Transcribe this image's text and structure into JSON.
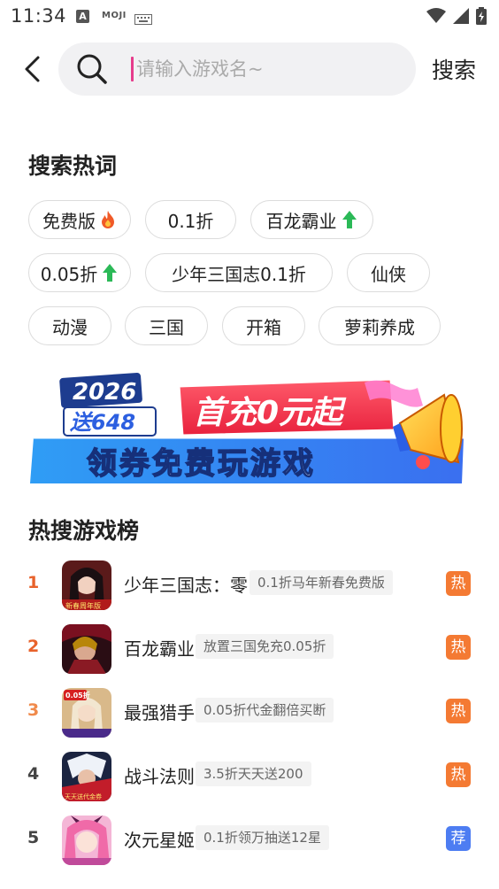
{
  "status_bar": {
    "time": "11:34",
    "app_a": "A",
    "app_moji": "MOJI"
  },
  "search": {
    "placeholder": "请输入游戏名~",
    "value": "",
    "button_label": "搜索"
  },
  "hot_words": {
    "title": "搜索热词",
    "chips": [
      {
        "label": "免费版",
        "icon": "fire-icon"
      },
      {
        "label": "0.1折",
        "icon": ""
      },
      {
        "label": "百龙霸业",
        "icon": "arrow-up-icon"
      },
      {
        "label": "0.05折",
        "icon": "arrow-up-icon"
      },
      {
        "label": "少年三国志0.1折",
        "icon": ""
      },
      {
        "label": "仙侠",
        "icon": ""
      },
      {
        "label": "动漫",
        "icon": ""
      },
      {
        "label": "三国",
        "icon": ""
      },
      {
        "label": "开箱",
        "icon": ""
      },
      {
        "label": "萝莉养成",
        "icon": ""
      }
    ]
  },
  "banner": {
    "year": "2026",
    "gift": "送648",
    "headline": "首充0元起",
    "subline": "领券免费玩游戏"
  },
  "ranking": {
    "title": "热搜游戏榜",
    "items": [
      {
        "rank": "1",
        "name": "少年三国志：零",
        "tag": "0.1折马年新春免费版",
        "badge": "热",
        "thumb_text": "新春周年版"
      },
      {
        "rank": "2",
        "name": "百龙霸业",
        "tag": "放置三国免充0.05折",
        "badge": "热",
        "thumb_text": ""
      },
      {
        "rank": "3",
        "name": "最强猎手",
        "tag": "0.05折代金翻倍买断",
        "badge": "热",
        "thumb_text": "0.05折"
      },
      {
        "rank": "4",
        "name": "战斗法则",
        "tag": "3.5折天天送200",
        "badge": "热",
        "thumb_text": "天天送代金券"
      },
      {
        "rank": "5",
        "name": "次元星姬",
        "tag": "0.1折领万抽送12星",
        "badge": "荐",
        "thumb_text": ""
      }
    ]
  },
  "colors": {
    "rank_1": "#e8622b",
    "rank_2": "#e8622b",
    "rank_3": "#f08a4b",
    "rank_4": "#444444",
    "rank_5": "#444444",
    "badge_hot": "#f47a33",
    "badge_recommend": "#4d7df2",
    "caret": "#e63c8c"
  }
}
